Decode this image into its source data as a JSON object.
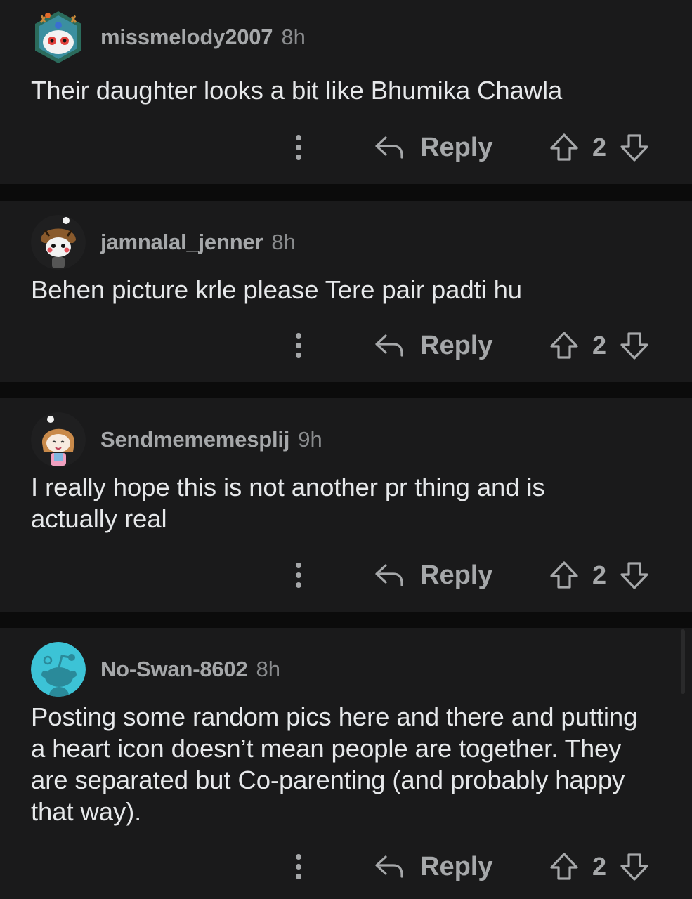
{
  "comments": [
    {
      "avatar_icon": "deer-snoo-avatar",
      "username": "missmelody2007",
      "time": "8h",
      "text": "Their daughter looks a bit like Bhumika Chawla",
      "reply_label": "Reply",
      "score": "2"
    },
    {
      "avatar_icon": "tiger-hood-snoo-avatar",
      "username": "jamnalal_jenner",
      "time": "8h",
      "text": "Behen picture krle please Tere pair padti hu",
      "reply_label": "Reply",
      "score": "2"
    },
    {
      "avatar_icon": "girl-snoo-avatar",
      "username": "Sendmememesplij",
      "time": "9h",
      "text": "I really hope this is not another pr thing and is actually real",
      "reply_label": "Reply",
      "score": "2"
    },
    {
      "avatar_icon": "default-snoo-avatar",
      "username": "No-Swan-8602",
      "time": "8h",
      "text": "Posting some random pics here and there and putting a heart icon doesn’t mean people are together. They are separated but Co-parenting (and probably happy that way).",
      "reply_label": "Reply",
      "score": "2"
    }
  ],
  "colors": {
    "background": "#0b0b0b",
    "card": "#1a1a1b",
    "text": "#e6e8ea",
    "muted": "#a6a8aa",
    "default_avatar": "#3cc3d6"
  }
}
